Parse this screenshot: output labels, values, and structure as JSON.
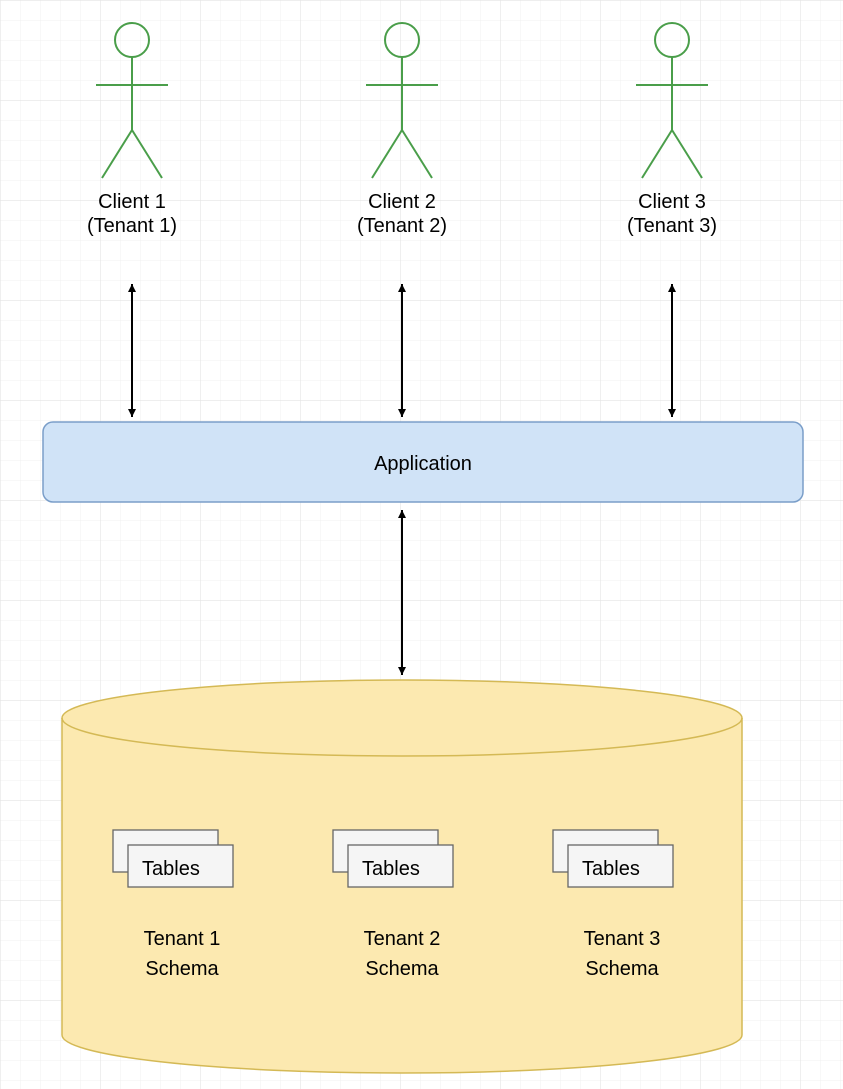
{
  "diagram": {
    "clients": [
      {
        "name": "Client 1",
        "tenant": "(Tenant 1)"
      },
      {
        "name": "Client 2",
        "tenant": "(Tenant 2)"
      },
      {
        "name": "Client 3",
        "tenant": "(Tenant 3)"
      }
    ],
    "application_label": "Application",
    "database": {
      "schemas": [
        {
          "tables_label": "Tables",
          "schema_line1": "Tenant 1",
          "schema_line2": "Schema"
        },
        {
          "tables_label": "Tables",
          "schema_line1": "Tenant 2",
          "schema_line2": "Schema"
        },
        {
          "tables_label": "Tables",
          "schema_line1": "Tenant 3",
          "schema_line2": "Schema"
        }
      ]
    }
  },
  "colors": {
    "grid_minor": "#f0f0f0",
    "grid_major": "#e4e4e4",
    "actor_stroke": "#4a9e4a",
    "app_fill": "#d0e3f7",
    "app_stroke": "#7a9ec9",
    "db_fill": "#fce9b0",
    "db_stroke": "#d4b955",
    "tables_fill": "#f5f5f5",
    "tables_stroke": "#666666",
    "arrow": "#000000"
  }
}
